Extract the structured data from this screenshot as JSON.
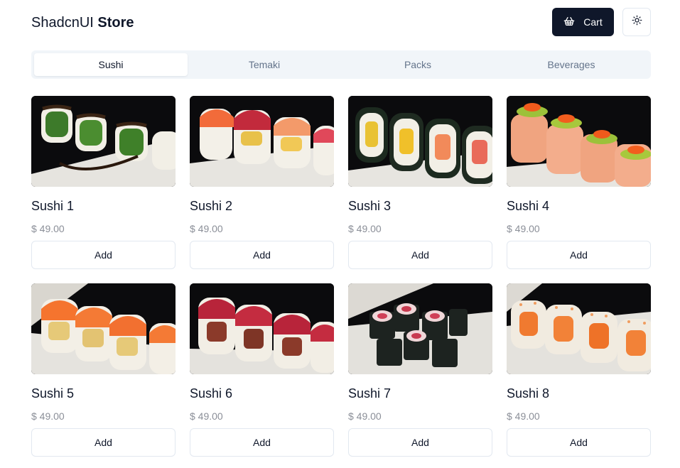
{
  "header": {
    "brand_light": "ShadcnUI",
    "brand_bold": "Store",
    "cart_label": "Cart",
    "cart_icon": "shopping-basket-icon",
    "theme_icon": "sun-icon"
  },
  "tabs": [
    {
      "label": "Sushi",
      "active": true
    },
    {
      "label": "Temaki",
      "active": false
    },
    {
      "label": "Packs",
      "active": false
    },
    {
      "label": "Beverages",
      "active": false
    }
  ],
  "products": [
    {
      "name": "Sushi 1",
      "price": "$ 49.00",
      "add_label": "Add"
    },
    {
      "name": "Sushi 2",
      "price": "$ 49.00",
      "add_label": "Add"
    },
    {
      "name": "Sushi 3",
      "price": "$ 49.00",
      "add_label": "Add"
    },
    {
      "name": "Sushi 4",
      "price": "$ 49.00",
      "add_label": "Add"
    },
    {
      "name": "Sushi 5",
      "price": "$ 49.00",
      "add_label": "Add"
    },
    {
      "name": "Sushi 6",
      "price": "$ 49.00",
      "add_label": "Add"
    },
    {
      "name": "Sushi 7",
      "price": "$ 49.00",
      "add_label": "Add"
    },
    {
      "name": "Sushi 8",
      "price": "$ 49.00",
      "add_label": "Add"
    }
  ],
  "colors": {
    "primary": "#0f172a",
    "muted_bg": "#f1f5f9",
    "muted_text": "#64748b",
    "border": "#e2e8f0"
  }
}
